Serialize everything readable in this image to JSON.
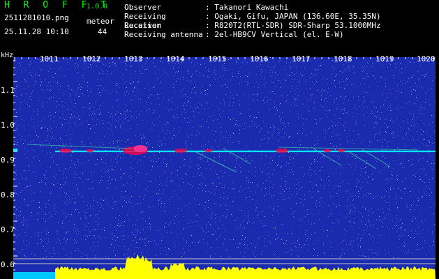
{
  "app": {
    "title": "H R O F F T",
    "version": "1.0.0",
    "filename": "2511281010.png",
    "meteor_label": "meteor",
    "datetime": "25.11.28 10:10",
    "meteor_count": "44"
  },
  "info": [
    {
      "label": "Observer",
      "value": ": Takanori Kawachi"
    },
    {
      "label": "Receiving Location",
      "value": ": Ogaki, Gifu, JAPAN (136.60E, 35.35N)"
    },
    {
      "label": "Receiver",
      "value": ": R820T2(RTL-SDR) SDR-Sharp 53.1000MHz"
    },
    {
      "label": "Receiving antenna",
      "value": ": 2el-HB9CV Vertical (el. E-W)"
    }
  ],
  "axis": {
    "y_unit": "kHz",
    "y_ticks": [
      "1.1",
      "1.0",
      "0.9",
      "0.8",
      "0.7",
      "0.6"
    ],
    "x_ticks": [
      "1011",
      "1012",
      "1013",
      "1014",
      "1015",
      "1016",
      "1017",
      "1018",
      "1019",
      "1020"
    ]
  },
  "colors": {
    "background": "#1b2bb0",
    "signal_cyan": "#00ffff",
    "signal_red": "#ff0044",
    "level_yellow": "#ffff00"
  }
}
